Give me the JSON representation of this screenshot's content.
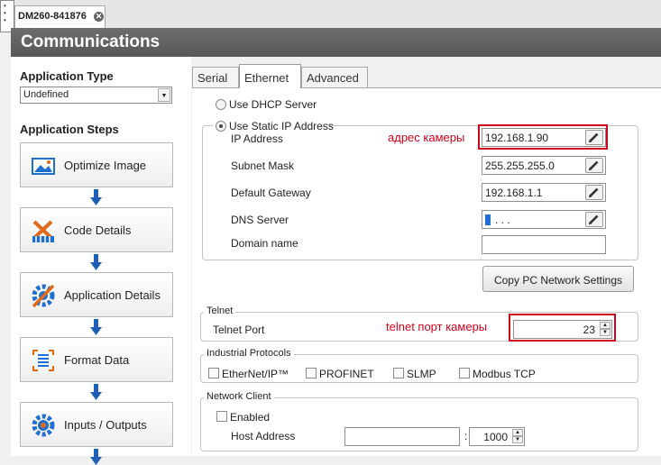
{
  "document_tab": {
    "title": "DM260-841876"
  },
  "header": {
    "title": "Communications"
  },
  "left": {
    "app_type_label": "Application Type",
    "app_type_value": "Undefined",
    "steps_label": "Application Steps",
    "steps": [
      {
        "label": "Optimize Image",
        "icon": "image-icon"
      },
      {
        "label": "Code Details",
        "icon": "tools-icon"
      },
      {
        "label": "Application Details",
        "icon": "gear-wrench-icon"
      },
      {
        "label": "Format Data",
        "icon": "format-data-icon"
      },
      {
        "label": "Inputs / Outputs",
        "icon": "gear-icon"
      }
    ]
  },
  "tabs": {
    "serial": "Serial",
    "ethernet": "Ethernet",
    "advanced": "Advanced"
  },
  "ethernet": {
    "dhcp_label": "Use DHCP Server",
    "static_label": "Use Static IP Address",
    "ip_label": "IP Address",
    "ip_value": "192.168.1.90",
    "subnet_label": "Subnet Mask",
    "subnet_value": "255.255.255.0",
    "gateway_label": "Default Gateway",
    "gateway_value": "192.168.1.1",
    "dns_label": "DNS Server",
    "dns_value": ".  .  .",
    "domain_label": "Domain name",
    "domain_value": "",
    "copy_button": "Copy PC Network Settings"
  },
  "telnet": {
    "legend": "Telnet",
    "port_label": "Telnet Port",
    "port_value": "23"
  },
  "protocols": {
    "legend": "Industrial Protocols",
    "items": [
      "EtherNet/IP™",
      "PROFINET",
      "SLMP",
      "Modbus TCP"
    ]
  },
  "network_client": {
    "legend": "Network Client",
    "enabled_label": "Enabled",
    "host_label": "Host Address",
    "host_value": "",
    "separator": ":",
    "port_value": "1000"
  },
  "annotations": {
    "camera_address": "адрес камеры",
    "camera_telnet_port": "telnet порт камеры"
  },
  "colors": {
    "header_bg": "#606060",
    "annotation": "#d0021b",
    "accent_blue": "#1f6fd0",
    "accent_orange": "#e06a1a"
  }
}
